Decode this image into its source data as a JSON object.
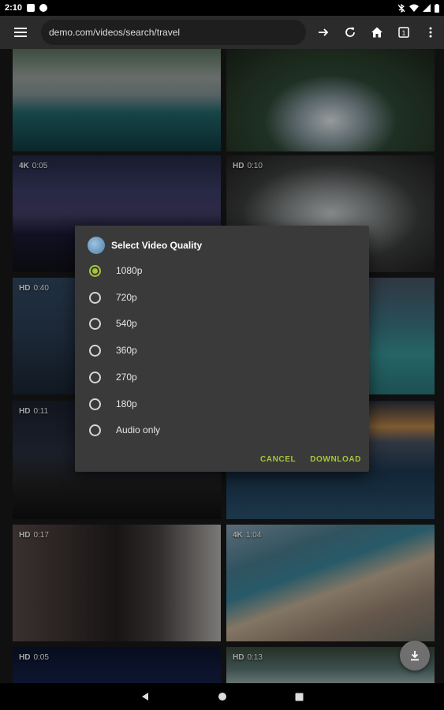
{
  "status_bar": {
    "time": "2:10"
  },
  "toolbar": {
    "url": "demo.com/videos/search/travel"
  },
  "grid": {
    "tiles": [
      {
        "quality": "",
        "duration": ""
      },
      {
        "quality": "",
        "duration": ""
      },
      {
        "quality": "4K",
        "duration": "0:05"
      },
      {
        "quality": "HD",
        "duration": "0:10"
      },
      {
        "quality": "HD",
        "duration": "0:40"
      },
      {
        "quality": "",
        "duration": ""
      },
      {
        "quality": "HD",
        "duration": "0:11"
      },
      {
        "quality": "",
        "duration": ""
      },
      {
        "quality": "HD",
        "duration": "0:17"
      },
      {
        "quality": "4K",
        "duration": "1:04"
      },
      {
        "quality": "HD",
        "duration": "0:05"
      },
      {
        "quality": "HD",
        "duration": "0:13"
      }
    ]
  },
  "dialog": {
    "title": "Select Video Quality",
    "options": [
      "1080p",
      "720p",
      "540p",
      "360p",
      "270p",
      "180p",
      "Audio only"
    ],
    "selected": "1080p",
    "cancel_label": "CANCEL",
    "download_label": "DOWNLOAD"
  },
  "colors": {
    "accent": "#a4c639",
    "dialog_bg": "#3a3a3a",
    "toolbar_bg": "#2b2b2b"
  }
}
